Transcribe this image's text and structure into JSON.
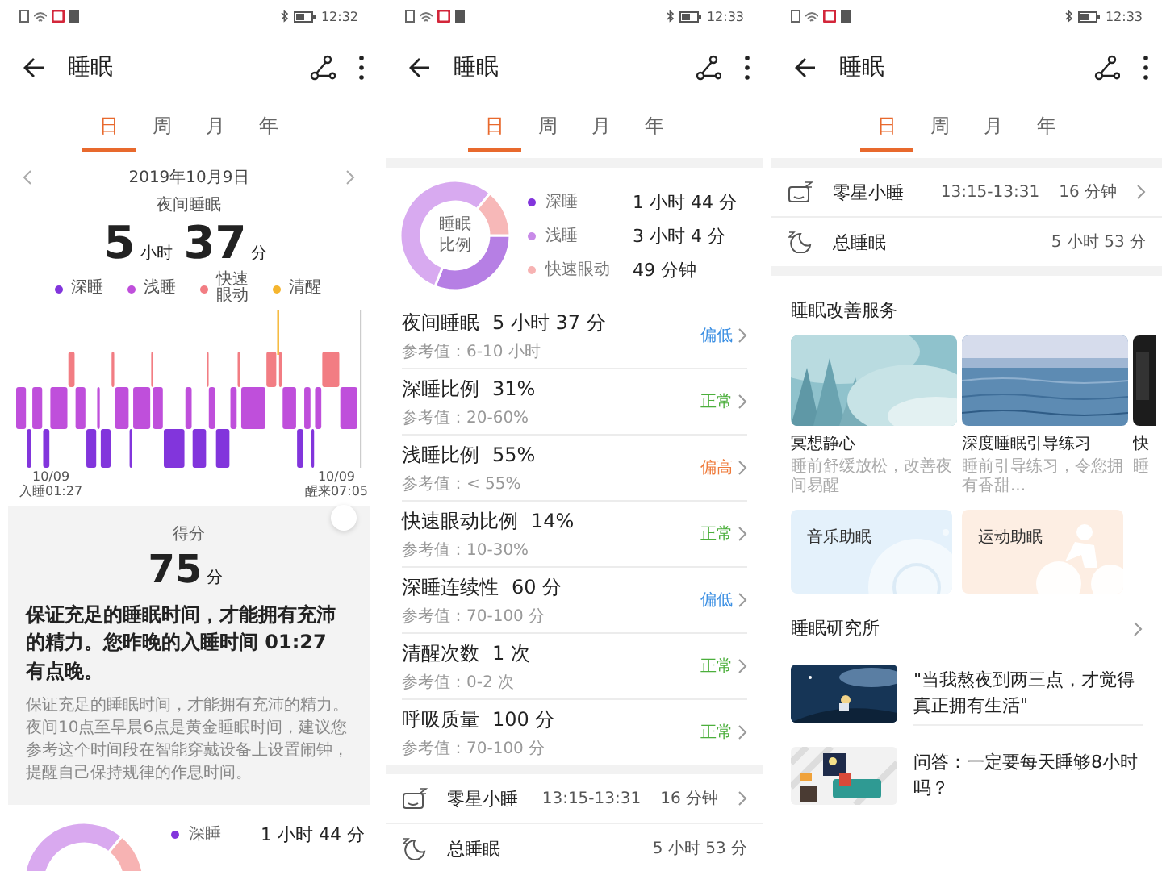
{
  "screens": [
    {
      "kind": "overview",
      "status_bar": {
        "time": "12:32"
      },
      "header": {
        "title": "睡眠"
      },
      "tabs": [
        {
          "label": "日",
          "selected": true
        },
        {
          "label": "周",
          "selected": false
        },
        {
          "label": "月",
          "selected": false
        },
        {
          "label": "年",
          "selected": false
        }
      ],
      "date_nav": {
        "date": "2019年10月9日"
      },
      "summary": {
        "label": "夜间睡眠",
        "hours": "5",
        "hours_unit": "小时",
        "minutes": "37",
        "minutes_unit": "分"
      },
      "legend": [
        {
          "label": "深睡",
          "color": "#8235dc"
        },
        {
          "label": "浅睡",
          "color": "#bf4fdb"
        },
        {
          "label": "快速眼动",
          "color": "#f27d83"
        },
        {
          "label": "清醒",
          "color": "#f5b52e"
        }
      ],
      "sleep_start": {
        "date": "10/09",
        "label": "入睡01:27"
      },
      "wake_up": {
        "date": "10/09",
        "label": "醒来07:05"
      },
      "score": {
        "label": "得分",
        "value": "75",
        "unit": "分",
        "headline": "保证充足的睡眠时间，才能拥有充沛的精力。您昨晚的入睡时间 01:27 有点晚。",
        "advice": "保证充足的睡眠时间，才能拥有充沛的精力。夜间10点至早晨6点是黄金睡眠时间，建议您参考这个时间段在智能穿戴设备上设置闹钟，提醒自己保持规律的作息时间。"
      },
      "ratio": {
        "legend": [
          {
            "label": "深睡",
            "value": "1 小时 44 分",
            "color": "#8235dc"
          }
        ]
      }
    },
    {
      "kind": "details",
      "status_bar": {
        "time": "12:33"
      },
      "header": {
        "title": "睡眠"
      },
      "tabs": [
        {
          "label": "日",
          "selected": true
        },
        {
          "label": "周",
          "selected": false
        },
        {
          "label": "月",
          "selected": false
        },
        {
          "label": "年",
          "selected": false
        }
      ],
      "ratio": {
        "center_label": "睡眠比例",
        "chart_data": {
          "type": "donut",
          "categories": [
            "深睡",
            "浅睡",
            "快速眼动"
          ],
          "values": [
            31,
            55,
            14
          ]
        },
        "legend": [
          {
            "value": "1 小时 44 分",
            "color": "#8235dc"
          },
          {
            "value": "3 小时 4 分",
            "color": "#c88ae8"
          },
          {
            "value": "49 分钟",
            "color": "#f7b3b3"
          }
        ]
      },
      "metrics": [
        {
          "title": "夜间睡眠",
          "value": "5 小时 37 分",
          "reference": "参考值：6-10 小时",
          "status": "偏低",
          "color": "#3b8fe3"
        },
        {
          "title": "深睡比例",
          "value": "31%",
          "reference": "参考值：20-60%",
          "status": "正常",
          "color": "#4caf3c"
        },
        {
          "title": "浅睡比例",
          "value": "55%",
          "reference": "参考值：< 55%",
          "status": "偏高",
          "color": "#ef7a3a"
        },
        {
          "title": "快速眼动比例",
          "value": "14%",
          "reference": "参考值：10-30%",
          "status": "正常",
          "color": "#4caf3c"
        },
        {
          "title": "深睡连续性",
          "value": "60 分",
          "reference": "参考值：70-100 分",
          "status": "偏低",
          "color": "#3b8fe3"
        },
        {
          "title": "清醒次数",
          "value": "1 次",
          "reference": "参考值：0-2 次",
          "status": "正常",
          "color": "#4caf3c"
        },
        {
          "title": "呼吸质量",
          "value": "100 分",
          "reference": "参考值：70-100 分",
          "status": "正常",
          "color": "#4caf3c"
        }
      ],
      "naps": [
        {
          "kind": "nap",
          "label": "零星小睡",
          "time": "13:15-13:31",
          "value": "16 分钟",
          "chevron": true
        },
        {
          "kind": "total",
          "label": "总睡眠",
          "value": "5 小时 53 分",
          "chevron": false
        }
      ]
    },
    {
      "kind": "services",
      "status_bar": {
        "time": "12:33"
      },
      "header": {
        "title": "睡眠"
      },
      "tabs": [
        {
          "label": "日",
          "selected": true
        },
        {
          "label": "周",
          "selected": false
        },
        {
          "label": "月",
          "selected": false
        },
        {
          "label": "年",
          "selected": false
        }
      ],
      "naps": [
        {
          "kind": "nap",
          "label": "零星小睡",
          "time": "13:15-13:31",
          "value": "16 分钟",
          "chevron": true
        },
        {
          "kind": "total",
          "label": "总睡眠",
          "value": "5 小时 53 分",
          "chevron": false
        }
      ],
      "services": {
        "title": "睡眠改善服务",
        "cards": [
          {
            "title": "冥想静心",
            "subtitle": "睡前舒缓放松，改善夜间易醒"
          },
          {
            "title": "深度睡眠引导练习",
            "subtitle": "睡前引导练习，令您拥有香甜..."
          },
          {
            "title": "快",
            "subtitle": "睡"
          }
        ],
        "tiles": [
          {
            "kind": "music",
            "label": "音乐助眠",
            "color": "#e4f1fb"
          },
          {
            "kind": "exercise",
            "label": "运动助眠",
            "color": "#fdeee3"
          }
        ]
      },
      "research": {
        "title": "睡眠研究所",
        "articles": [
          {
            "title": "\"当我熬夜到两三点，才觉得真正拥有生活\""
          },
          {
            "title": "问答：一定要每天睡够8小时吗？"
          }
        ]
      }
    }
  ]
}
